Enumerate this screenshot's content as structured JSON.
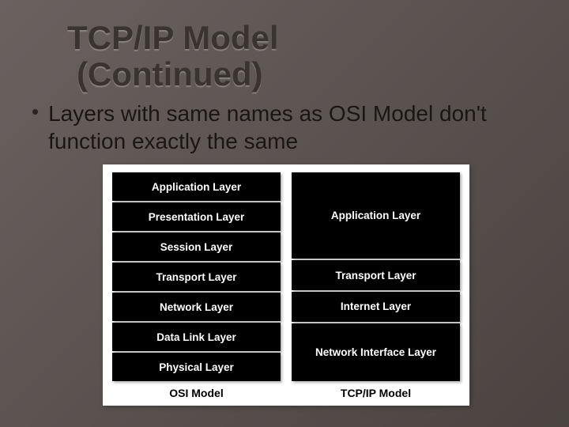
{
  "title_line1": "TCP/IP Model",
  "title_line2": "(Continued)",
  "bullet": "Layers with same names as OSI Model don't  function exactly the same",
  "diagram": {
    "osi": {
      "caption": "OSI Model",
      "layers": [
        "Application Layer",
        "Presentation Layer",
        "Session Layer",
        "Transport Layer",
        "Network Layer",
        "Data Link Layer",
        "Physical Layer"
      ]
    },
    "tcpip": {
      "caption": "TCP/IP Model",
      "layers": [
        {
          "label": "Application Layer",
          "span": 3
        },
        {
          "label": "Transport Layer",
          "span": 1
        },
        {
          "label": "Internet Layer",
          "span": 1
        },
        {
          "label": "Network Interface Layer",
          "span": 2
        }
      ]
    }
  }
}
